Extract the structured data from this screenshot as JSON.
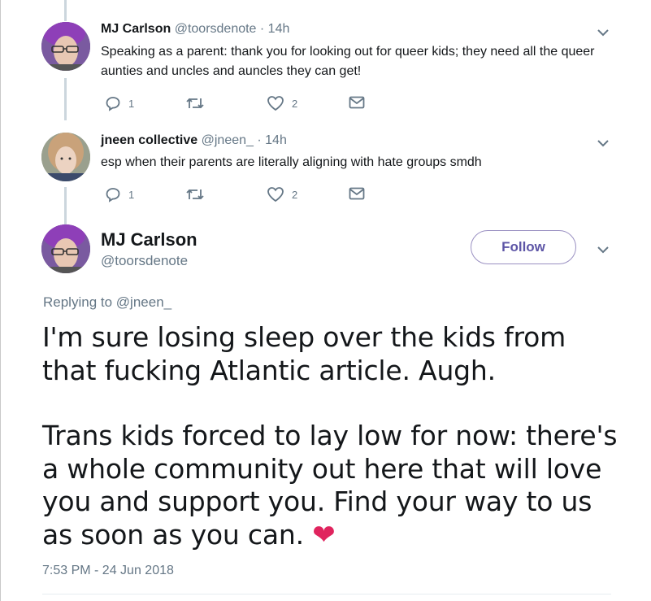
{
  "replies": [
    {
      "name": "MJ Carlson",
      "handle": "@toorsdenote",
      "time": "· 14h",
      "text": "Speaking as a parent: thank you for looking out for queer kids; they need all the queer aunties and uncles and auncles they can get!",
      "reply_count": "1",
      "retweet_count": "",
      "like_count": "2"
    },
    {
      "name": "jneen collective",
      "handle": "@jneen_",
      "time": "· 14h",
      "text": "esp when their parents are literally aligning with hate groups smdh",
      "reply_count": "1",
      "retweet_count": "",
      "like_count": "2"
    }
  ],
  "main_tweet": {
    "name": "MJ Carlson",
    "handle": "@toorsdenote",
    "follow_label": "Follow",
    "replying_prefix": "Replying to",
    "replying_to": "@jneen_",
    "paragraph_1": "I'm sure losing sleep over the kids from that fucking Atlantic article. Augh.",
    "paragraph_2": "Trans kids forced to lay low for now: there's a whole community out here that will love you and support you. Find your way to us as soon as you can.",
    "emoji": "❤",
    "timestamp": "7:53 PM - 24 Jun 2018"
  },
  "icons": [
    "reply-icon",
    "retweet-icon",
    "like-icon",
    "message-icon",
    "chevron-down-icon",
    "heart-emoji"
  ],
  "colors": {
    "muted": "#657786",
    "text": "#14171a",
    "thread_line": "#ccd6dd",
    "follow": "#5d55a6",
    "heart": "#e0245e"
  }
}
